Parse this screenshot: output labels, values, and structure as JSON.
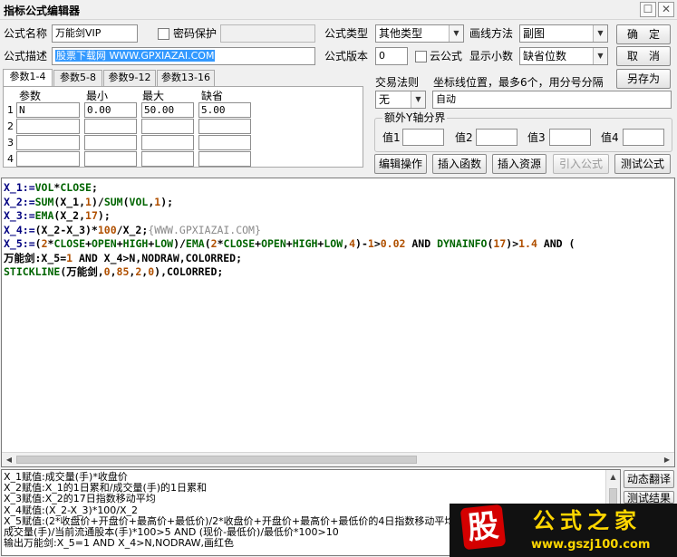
{
  "window": {
    "title": "指标公式编辑器",
    "restore_glyph": "☐",
    "close_glyph": "✕"
  },
  "form": {
    "name_label": "公式名称",
    "name_value": "万能剑VIP",
    "password_label": "密码保护",
    "desc_label": "公式描述",
    "desc_value": "股票下载网 WWW.GPXIAZAI.COM",
    "type_label": "公式类型",
    "type_value": "其他类型",
    "draw_label": "画线方法",
    "draw_value": "副图",
    "version_label": "公式版本",
    "version_value": "0",
    "cloud_label": "云公式",
    "decimals_label": "显示小数",
    "decimals_value": "缺省位数"
  },
  "buttons": {
    "ok": "确　定",
    "cancel": "取　消",
    "save_as": "另存为",
    "edit_ops": "编辑操作",
    "insert_func": "插入函数",
    "insert_res": "插入资源",
    "import_formula": "引入公式",
    "test_formula": "测试公式",
    "dyn_translate": "动态翻译",
    "test_result": "测试结果"
  },
  "params": {
    "tabs": [
      "参数1-4",
      "参数5-8",
      "参数9-12",
      "参数13-16"
    ],
    "headers": [
      "参数",
      "最小",
      "最大",
      "缺省"
    ],
    "rows": [
      {
        "num": "1",
        "name": "N",
        "min": "0.00",
        "max": "50.00",
        "default": "5.00"
      },
      {
        "num": "2",
        "name": "",
        "min": "",
        "max": "",
        "default": ""
      },
      {
        "num": "3",
        "name": "",
        "min": "",
        "max": "",
        "default": ""
      },
      {
        "num": "4",
        "name": "",
        "min": "",
        "max": "",
        "default": ""
      }
    ]
  },
  "trade": {
    "rule_label": "交易法则",
    "rule_value": "无",
    "coord_label": "坐标线位置，最多6个，用分号分隔",
    "coord_value": "自动"
  },
  "extra_y": {
    "title": "额外Y轴分界",
    "labels": [
      "值1",
      "值2",
      "值3",
      "值4"
    ]
  },
  "code_lines": [
    [
      [
        "X_1:=",
        "var"
      ],
      [
        "VOL",
        "fn"
      ],
      [
        "*",
        "plain"
      ],
      [
        "CLOSE",
        "fn"
      ],
      [
        ";",
        "plain"
      ]
    ],
    [
      [
        "X_2:=",
        "var"
      ],
      [
        "SUM",
        "fn"
      ],
      [
        "(X_1,",
        "plain"
      ],
      [
        "1",
        "num"
      ],
      [
        ")/",
        "plain"
      ],
      [
        "SUM",
        "fn"
      ],
      [
        "(",
        "plain"
      ],
      [
        "VOL",
        "fn"
      ],
      [
        ",",
        "plain"
      ],
      [
        "1",
        "num"
      ],
      [
        ");",
        "plain"
      ]
    ],
    [
      [
        "X_3:=",
        "var"
      ],
      [
        "EMA",
        "fn"
      ],
      [
        "(X_2,",
        "plain"
      ],
      [
        "17",
        "num"
      ],
      [
        ");",
        "plain"
      ]
    ],
    [
      [
        "X_4:=",
        "var"
      ],
      [
        "(X_2-X_3)*",
        "plain"
      ],
      [
        "100",
        "num"
      ],
      [
        "/X_2;",
        "plain"
      ],
      [
        "{WWW.GPXIAZAI.COM}",
        "comment"
      ]
    ],
    [
      [
        "X_5:=",
        "var"
      ],
      [
        "(",
        "plain"
      ],
      [
        "2",
        "num"
      ],
      [
        "*",
        "plain"
      ],
      [
        "CLOSE",
        "fn"
      ],
      [
        "+",
        "plain"
      ],
      [
        "OPEN",
        "fn"
      ],
      [
        "+",
        "plain"
      ],
      [
        "HIGH",
        "fn"
      ],
      [
        "+",
        "plain"
      ],
      [
        "LOW",
        "fn"
      ],
      [
        ")/",
        "plain"
      ],
      [
        "EMA",
        "fn"
      ],
      [
        "(",
        "plain"
      ],
      [
        "2",
        "num"
      ],
      [
        "*",
        "plain"
      ],
      [
        "CLOSE",
        "fn"
      ],
      [
        "+",
        "plain"
      ],
      [
        "OPEN",
        "fn"
      ],
      [
        "+",
        "plain"
      ],
      [
        "HIGH",
        "fn"
      ],
      [
        "+",
        "plain"
      ],
      [
        "LOW",
        "fn"
      ],
      [
        ",",
        "plain"
      ],
      [
        "4",
        "num"
      ],
      [
        ")-",
        "plain"
      ],
      [
        "1",
        "num"
      ],
      [
        ">",
        "plain"
      ],
      [
        "0.02",
        "num"
      ],
      [
        " AND ",
        "plain"
      ],
      [
        "DYNAINFO",
        "fn"
      ],
      [
        "(",
        "plain"
      ],
      [
        "17",
        "num"
      ],
      [
        ")>",
        "plain"
      ],
      [
        "1.4",
        "num"
      ],
      [
        " AND ",
        "plain"
      ],
      [
        "(",
        "plain"
      ]
    ],
    [
      [
        "万能剑:X_5=",
        "plain"
      ],
      [
        "1",
        "num"
      ],
      [
        " AND X_4>N,NODRAW,COLORRED;",
        "plain"
      ]
    ],
    [
      [
        "STICKLINE",
        "fn"
      ],
      [
        "(万能剑,",
        "plain"
      ],
      [
        "0",
        "num"
      ],
      [
        ",",
        "plain"
      ],
      [
        "85",
        "num"
      ],
      [
        ",",
        "plain"
      ],
      [
        "2",
        "num"
      ],
      [
        ",",
        "plain"
      ],
      [
        "0",
        "num"
      ],
      [
        "),COLORRED;",
        "plain"
      ]
    ]
  ],
  "explain_lines": [
    "X_1赋值:成交量(手)*收盘价",
    "X_2赋值:X_1的1日累和/成交量(手)的1日累和",
    "X_3赋值:X_2的17日指数移动平均",
    "X_4赋值:(X_2-X_3)*100/X_2",
    "X_5赋值:(2*收盘价+开盘价+最高价+最低价)/2*收盘价+开盘价+最高价+最低价的4日指数移动平均",
    "成交量(手)/当前流通股本(手)*100>5 AND (现价-最低价)/最低价*100>10",
    "输出万能剑:X_5=1 AND X_4>N,NODRAW,画红色"
  ],
  "watermark": {
    "badge": "股",
    "name": "公式之家",
    "url": "www.gszj100.com"
  },
  "icons": {
    "dropdown": "▼",
    "left": "◀",
    "right": "▶",
    "up": "▲",
    "down": "▼"
  }
}
